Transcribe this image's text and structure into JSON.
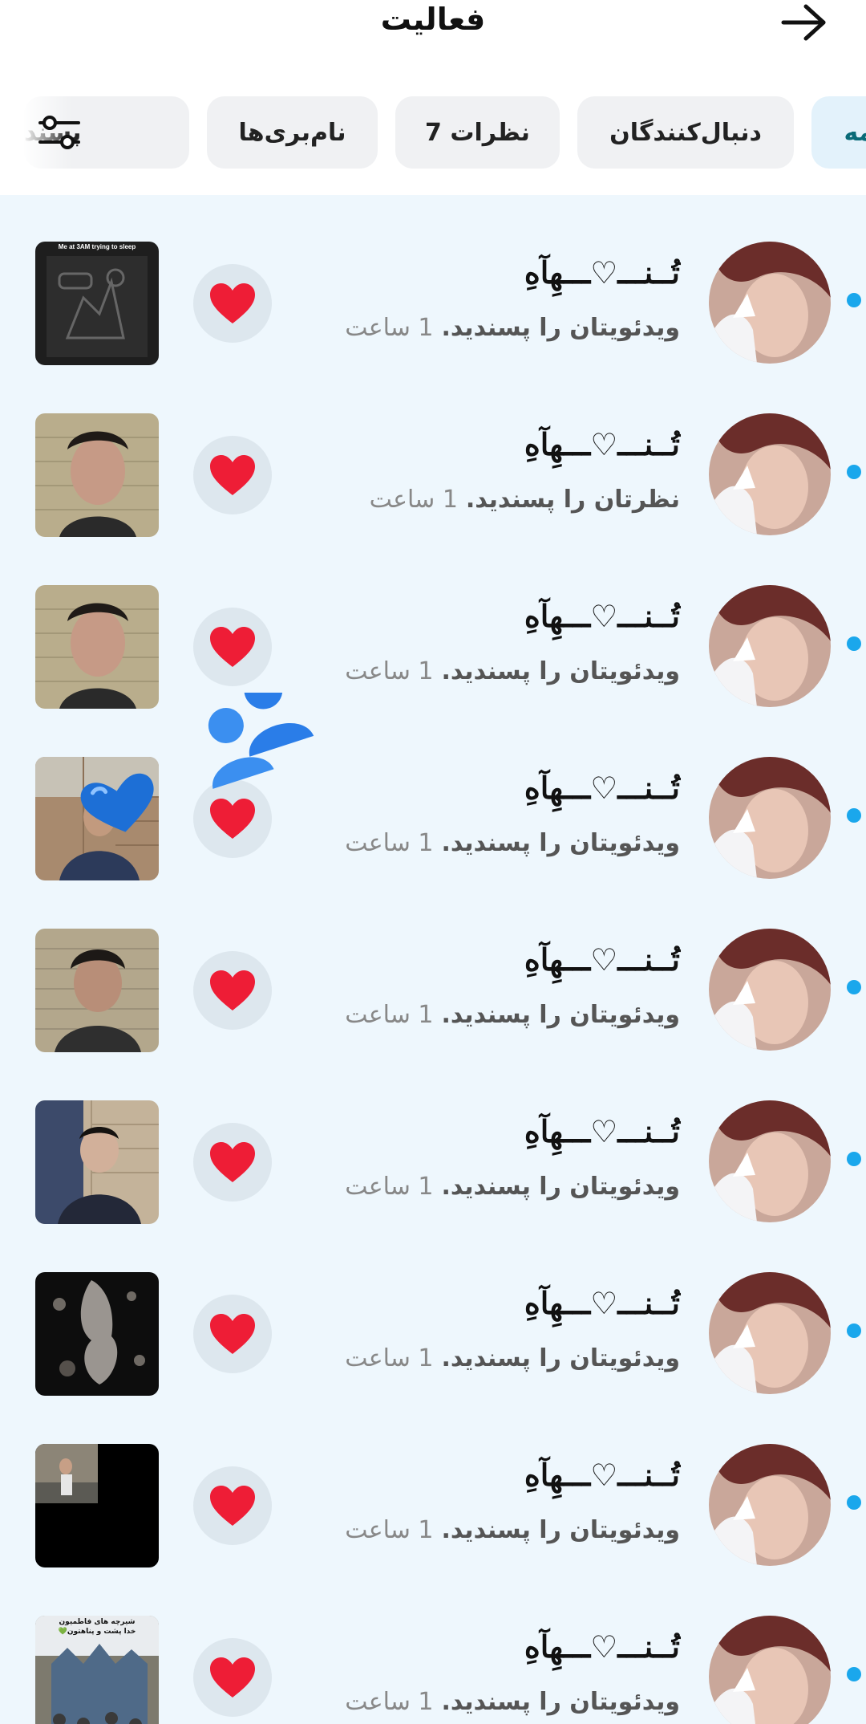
{
  "header": {
    "title": "فعالیت",
    "back_icon": "arrow-right-icon"
  },
  "tabs": [
    {
      "label": "همه",
      "active": true
    },
    {
      "label": "دنبال‌کنندگان",
      "active": false
    },
    {
      "label": "نظرات 7",
      "active": false
    },
    {
      "label": "نام‌بری‌ها",
      "active": false
    },
    {
      "label": "پسند",
      "active": false
    }
  ],
  "filter_icon": "sliders-icon",
  "accent_color": "#1aa7ec",
  "like_color": "#ee1d36",
  "notifications": [
    {
      "user": "تُــنـــ♡ـــهِآهِ",
      "action": "ویدئویتان را پسندید.",
      "time": "1 ساعت",
      "unread": true,
      "thumb": "sam-meme"
    },
    {
      "user": "تُــنـــ♡ـــهِآهِ",
      "action": "نظرتان را پسندید.",
      "time": "1 ساعت",
      "unread": true,
      "thumb": "selfie-wall"
    },
    {
      "user": "تُــنـــ♡ـــهِآهِ",
      "action": "ویدئویتان را پسندید.",
      "time": "1 ساعت",
      "unread": true,
      "thumb": "selfie-wall-heart"
    },
    {
      "user": "تُــنـــ♡ـــهِآهِ",
      "action": "ویدئویتان را پسندید.",
      "time": "1 ساعت",
      "unread": true,
      "thumb": "outdoor-brick"
    },
    {
      "user": "تُــنـــ♡ـــهِآهِ",
      "action": "ویدئویتان را پسندید.",
      "time": "1 ساعت",
      "unread": true,
      "thumb": "selfie-brick"
    },
    {
      "user": "تُــنـــ♡ـــهِآهِ",
      "action": "ویدئویتان را پسندید.",
      "time": "1 ساعت",
      "unread": true,
      "thumb": "sitting-brick"
    },
    {
      "user": "تُــنـــ♡ـــهِآهِ",
      "action": "ویدئویتان را پسندید.",
      "time": "1 ساعت",
      "unread": true,
      "thumb": "dark-leaves"
    },
    {
      "user": "تُــنـــ♡ـــهِآهِ",
      "action": "ویدئویتان را پسندید.",
      "time": "1 ساعت",
      "unread": true,
      "thumb": "black-frame"
    },
    {
      "user": "تُــنـــ♡ـــهِآهِ",
      "action": "ویدئویتان را پسندید.",
      "time": "1 ساعت",
      "unread": true,
      "thumb": "shrine-crowd"
    }
  ],
  "thumb_meme_caption": "Me at 3AM trying to sleep",
  "thumb_shrine_caption": "شیرچه های فاطمیون\nخدا پشت و پناهتون💚"
}
